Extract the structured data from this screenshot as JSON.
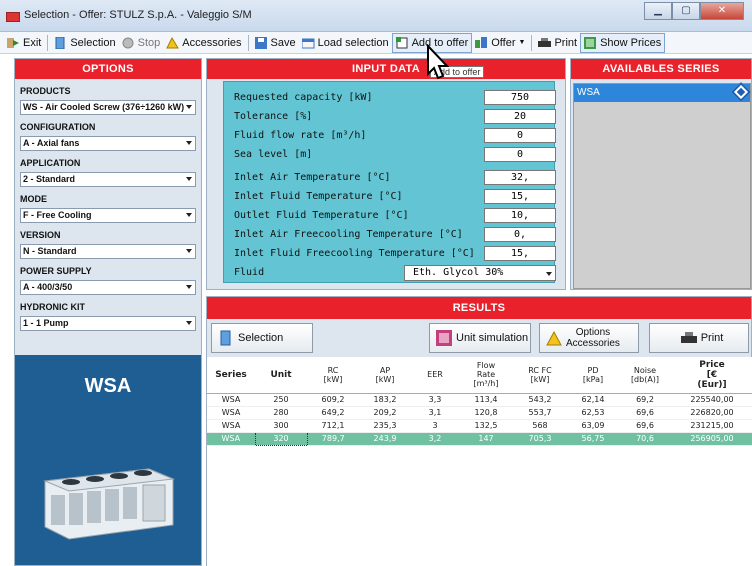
{
  "window": {
    "title": "Selection - Offer: STULZ S.p.A. - Valeggio S/M"
  },
  "toolbar": {
    "exit": "Exit",
    "selection": "Selection",
    "stop": "Stop",
    "accessories": "Accessories",
    "save": "Save",
    "load_selection": "Load selection",
    "add_to_offer": "Add to offer",
    "offer": "Offer",
    "print": "Print",
    "show_prices": "Show Prices",
    "tooltip": "Add to offer"
  },
  "options": {
    "header": "OPTIONS",
    "products_label": "PRODUCTS",
    "products_value": "WS - Air Cooled Screw (376÷1260 kW)",
    "configuration_label": "CONFIGURATION",
    "configuration_value": "A - Axial fans",
    "application_label": "APPLICATION",
    "application_value": "2 - Standard",
    "mode_label": "MODE",
    "mode_value": "F - Free Cooling",
    "version_label": "VERSION",
    "version_value": "N - Standard",
    "power_label": "POWER SUPPLY",
    "power_value": "A - 400/3/50",
    "hydronic_label": "HYDRONIC KIT",
    "hydronic_value": "1 - 1 Pump",
    "series_name": "WSA"
  },
  "input": {
    "header": "INPUT DATA",
    "rows": [
      {
        "label": "Requested capacity [kW]",
        "value": "750"
      },
      {
        "label": "Tolerance [%]",
        "value": "20"
      },
      {
        "label": "Fluid flow rate [m³/h]",
        "value": "0"
      },
      {
        "label": "Sea level [m]",
        "value": "0"
      },
      {
        "label": "Inlet Air Temperature [°C]",
        "value": "32,"
      },
      {
        "label": "Inlet Fluid Temperature [°C]",
        "value": "15,"
      },
      {
        "label": "Outlet Fluid Temperature [°C]",
        "value": "10,"
      },
      {
        "label": "Inlet Air Freecooling Temperature [°C]",
        "value": "0,"
      },
      {
        "label": "Inlet Fluid Freecooling Temperature [°C]",
        "value": "15,"
      }
    ],
    "fluid_label": "Fluid",
    "fluid_value": "Eth. Glycol 30%"
  },
  "available": {
    "header": "AVAILABLES SERIES",
    "items": [
      "WSA"
    ]
  },
  "results": {
    "header": "RESULTS",
    "btn_selection": "Selection",
    "btn_unit_sim": "Unit simulation",
    "btn_options_1": "Options",
    "btn_options_2": "Accessories",
    "btn_print": "Print",
    "columns": [
      "Series",
      "Unit",
      "RC\n[kW]",
      "AP\n[kW]",
      "EER",
      "Flow\nRate\n[m³/h]",
      "RC FC\n[kW]",
      "PD\n[kPa]",
      "Noise\n[db(A)]",
      "Price\n[€\n(Eur)]"
    ],
    "rows": [
      [
        "WSA",
        "250",
        "609,2",
        "183,2",
        "3,3",
        "113,4",
        "543,2",
        "62,14",
        "69,2",
        "225540,00"
      ],
      [
        "WSA",
        "280",
        "649,2",
        "209,2",
        "3,1",
        "120,8",
        "553,7",
        "62,53",
        "69,6",
        "226820,00"
      ],
      [
        "WSA",
        "300",
        "712,1",
        "235,3",
        "3",
        "132,5",
        "568",
        "63,09",
        "69,6",
        "231215,00"
      ],
      [
        "WSA",
        "320",
        "789,7",
        "243,9",
        "3,2",
        "147",
        "705,3",
        "56,75",
        "70,6",
        "256905,00"
      ]
    ]
  }
}
